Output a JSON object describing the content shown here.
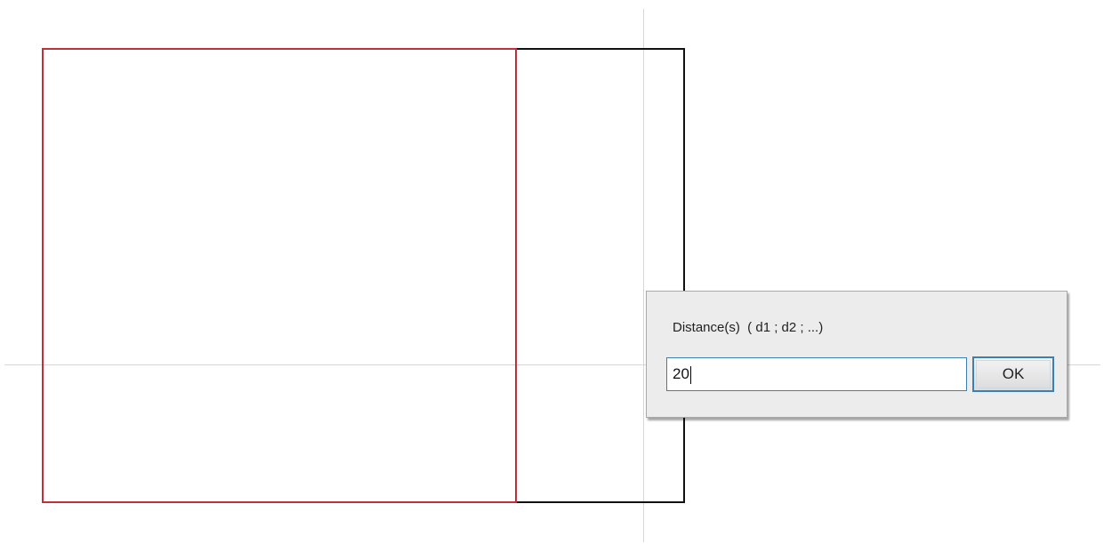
{
  "dialog": {
    "label": "Distance(s)  ( d1 ; d2 ; ...)",
    "input_value": "20",
    "ok_label": "OK"
  },
  "colors": {
    "selected_shape_stroke": "#c0303a",
    "shape_stroke": "#111111",
    "crosshair": "#d6d6d6",
    "dialog_bg": "#ececec",
    "focus_accent": "#3c7fb1"
  }
}
